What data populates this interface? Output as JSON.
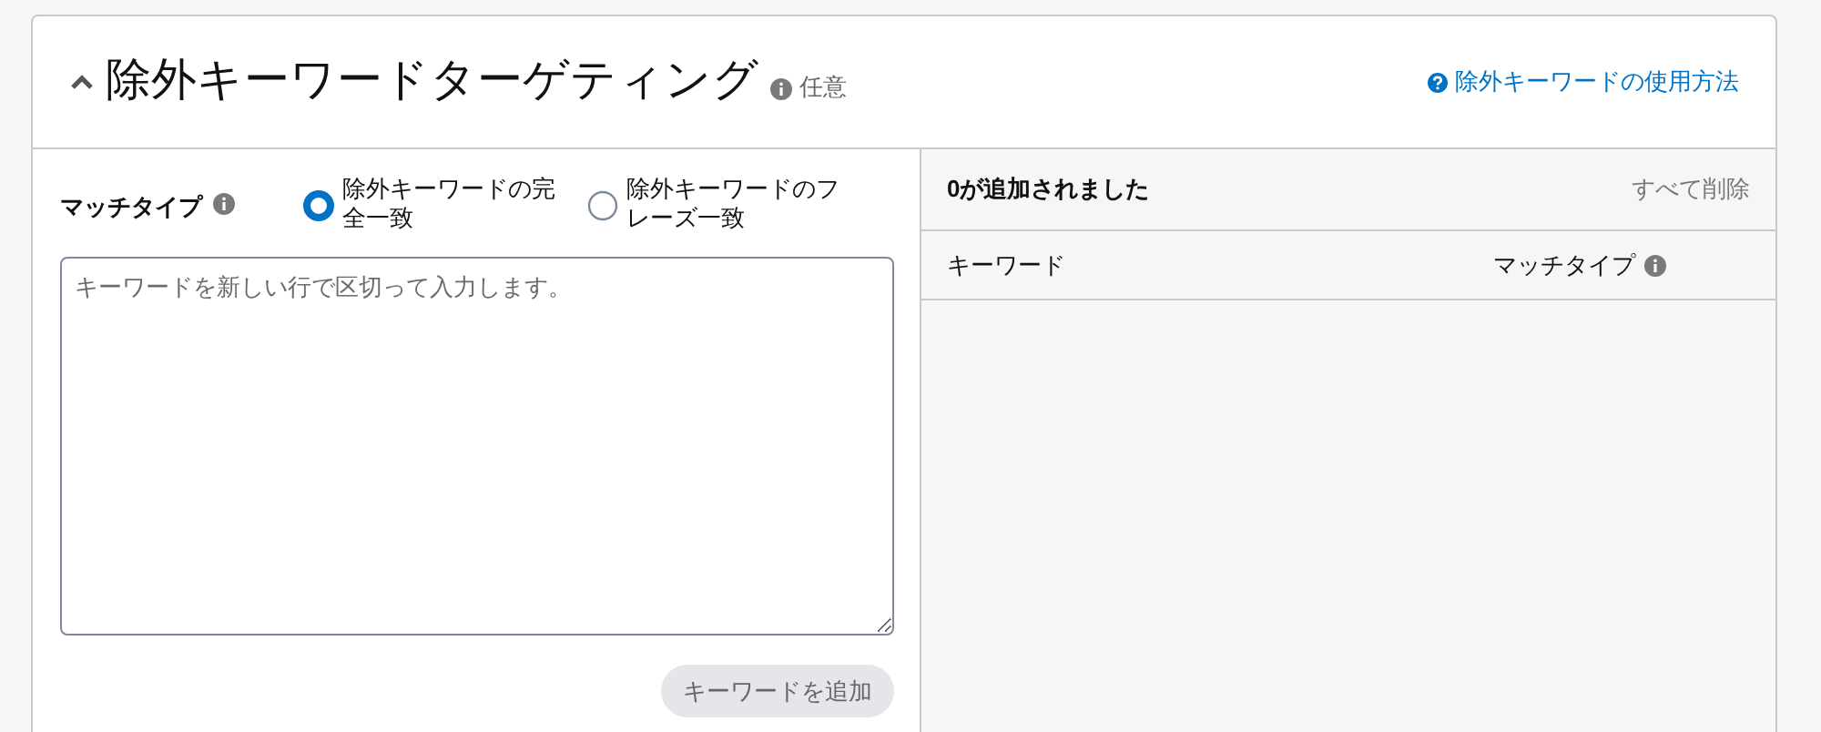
{
  "section": {
    "title": "除外キーワードターゲティング",
    "expanded": true,
    "optional_label": "任意",
    "help_link": "除外キーワードの使用方法"
  },
  "match_type": {
    "label": "マッチタイプ",
    "options": [
      {
        "label": "除外キーワードの完全一致",
        "selected": true
      },
      {
        "label": "除外キーワードのフレーズ一致",
        "selected": false
      }
    ]
  },
  "keywords_input": {
    "placeholder": "キーワードを新しい行で区切って入力します。"
  },
  "add_button": {
    "label": "キーワードを追加",
    "disabled": true
  },
  "added_panel": {
    "count_text": "0が追加されました",
    "clear_all": "すべて削除",
    "columns": [
      "キーワード",
      "マッチタイプ"
    ]
  }
}
